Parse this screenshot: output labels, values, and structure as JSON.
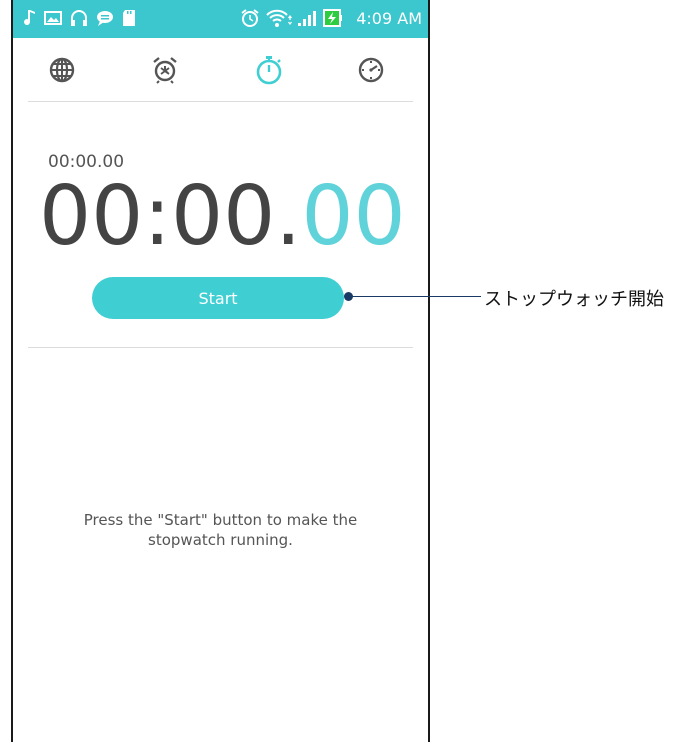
{
  "status_bar": {
    "time": "4:09 AM",
    "background": "#3cc6cd",
    "icons": [
      "music-note-icon",
      "image-icon",
      "headphones-icon",
      "chat-icon",
      "sd-card-icon",
      "alarm-icon",
      "wifi-icon",
      "signal-icon",
      "battery-charging-icon"
    ]
  },
  "tabs": [
    {
      "name": "world-clock",
      "icon": "globe-icon",
      "active": false
    },
    {
      "name": "alarm",
      "icon": "alarm-clock-icon",
      "active": false
    },
    {
      "name": "stopwatch",
      "icon": "stopwatch-icon",
      "active": true
    },
    {
      "name": "timer",
      "icon": "timer-icon",
      "active": false
    }
  ],
  "stopwatch": {
    "lap_time": "00:00.00",
    "main_time": "00:00.",
    "hundredths": "00",
    "start_label": "Start",
    "hint": "Press the \"Start\" button to make the stopwatch running."
  },
  "callout": {
    "text": "ストップウォッチ開始"
  },
  "colors": {
    "accent": "#3fcfd3",
    "accent_light": "#5fd3d9",
    "text_dark": "#444444",
    "callout_line": "#1a3a66"
  }
}
